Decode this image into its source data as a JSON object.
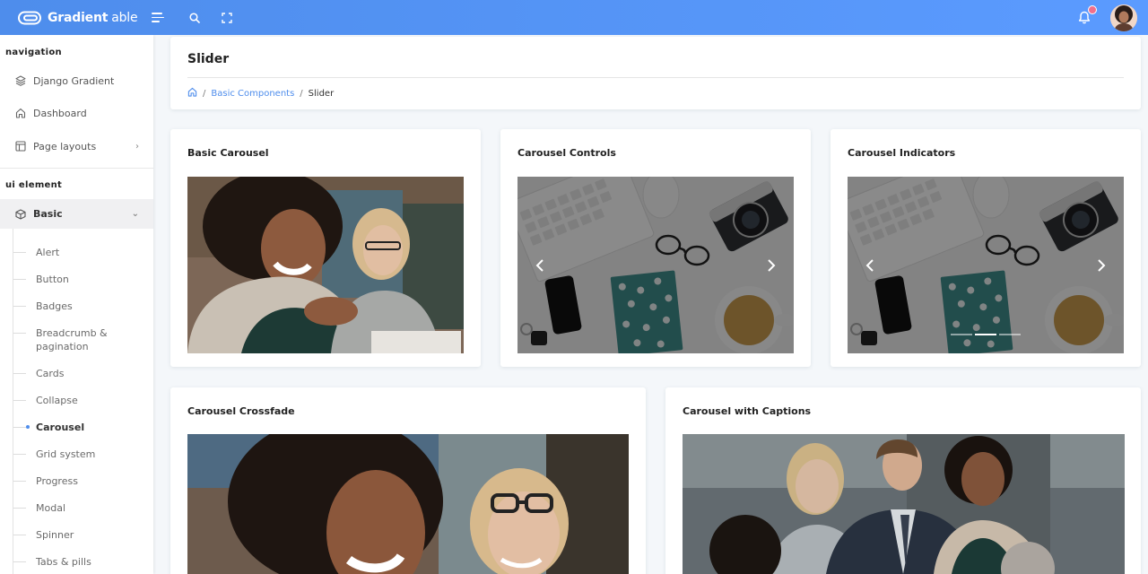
{
  "header": {
    "brand_bold": "Gradient",
    "brand_light": "able",
    "colors": {
      "header_from": "#4e8dec",
      "header_to": "#5b9bff",
      "accent": "#4e8dec"
    }
  },
  "sidebar": {
    "caption_navigation": "navigation",
    "nav_items": [
      {
        "label": "Django Gradient",
        "icon": "layers-icon"
      },
      {
        "label": "Dashboard",
        "icon": "home-icon"
      },
      {
        "label": "Page layouts",
        "icon": "layout-icon"
      }
    ],
    "caption_ui": "ui element",
    "basic_label": "Basic",
    "basic_icon": "box-icon",
    "sub_items": [
      "Alert",
      "Button",
      "Badges",
      "Breadcrumb & pagination",
      "Cards",
      "Collapse",
      "Carousel",
      "Grid system",
      "Progress",
      "Modal",
      "Spinner",
      "Tabs & pills"
    ],
    "active_sub_item": "Carousel"
  },
  "page_header": {
    "title": "Slider",
    "breadcrumb": {
      "home_icon": "home-icon",
      "parent": "Basic Components",
      "current": "Slider"
    }
  },
  "cards": {
    "basic_carousel": "Basic Carousel",
    "carousel_controls": "Carousel Controls",
    "carousel_indicators": "Carousel Indicators",
    "carousel_crossfade": "Carousel Crossfade",
    "carousel_captions": "Carousel with Captions"
  },
  "indicators": {
    "count": 3,
    "active_index": 1
  }
}
